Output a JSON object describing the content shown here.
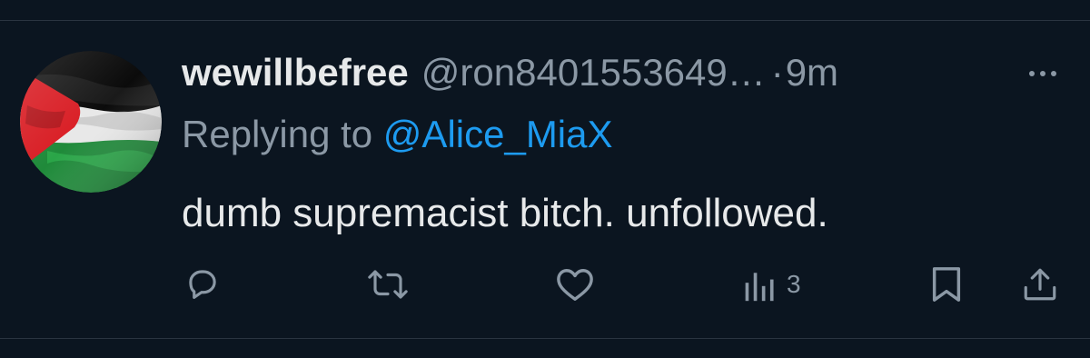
{
  "tweet": {
    "display_name": "wewillbefree",
    "handle": "@ron8401553649…",
    "separator": "·",
    "time": "9m",
    "replying_prefix": "Replying to",
    "replying_to": "@Alice_MiaX",
    "text": "dumb supremacist bitch. unfollowed.",
    "avatar_description": "palestine-flag-avatar"
  },
  "actions": {
    "reply": {
      "icon": "reply-icon"
    },
    "retweet": {
      "icon": "retweet-icon"
    },
    "like": {
      "icon": "heart-icon"
    },
    "views": {
      "icon": "views-icon",
      "count": "3"
    },
    "bookmark": {
      "icon": "bookmark-icon"
    },
    "share": {
      "icon": "share-icon"
    }
  },
  "colors": {
    "background": "#0b1520",
    "text": "#e7e9ea",
    "muted": "#8b98a5",
    "accent": "#1d9bf0",
    "divider": "#2a3440"
  }
}
